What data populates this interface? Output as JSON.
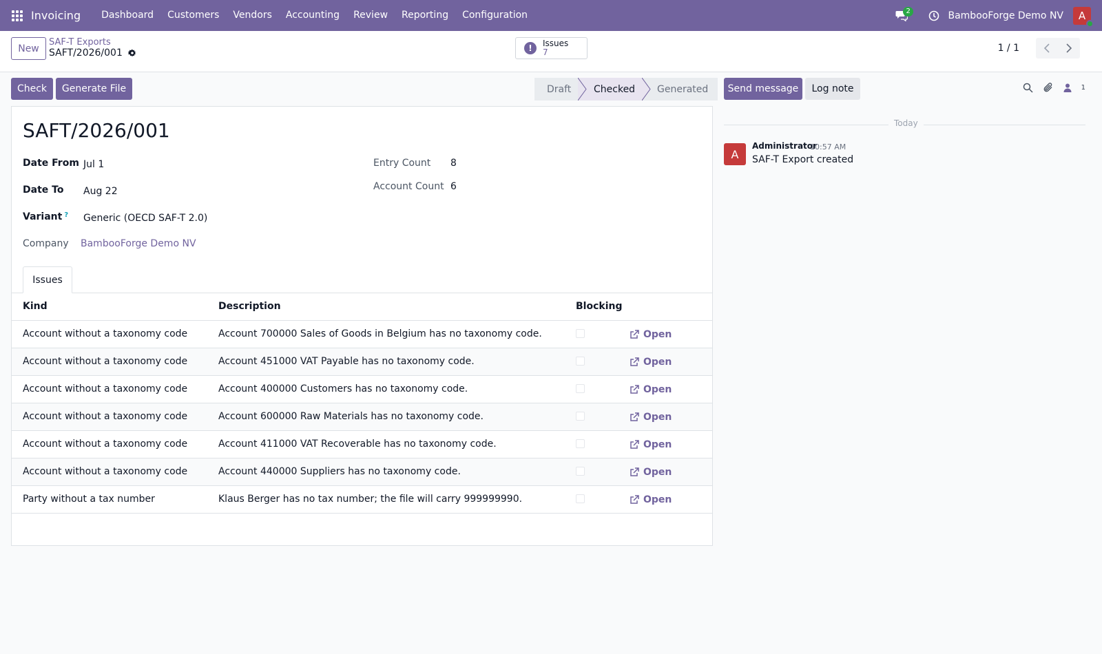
{
  "navbar": {
    "app_name": "Invoicing",
    "menu": [
      "Dashboard",
      "Customers",
      "Vendors",
      "Accounting",
      "Review",
      "Reporting",
      "Configuration"
    ],
    "chat_badge": "2",
    "company": "BambooForge Demo NV",
    "avatar_letter": "A"
  },
  "control_panel": {
    "new_label": "New",
    "breadcrumb": "SAF-T Exports",
    "record_name": "SAFT/2026/001",
    "smart_button": {
      "label": "Issues",
      "value": "7"
    },
    "pager": "1 / 1"
  },
  "actions": {
    "check_label": "Check",
    "generate_label": "Generate File"
  },
  "status": {
    "stages": [
      "Draft",
      "Checked",
      "Generated"
    ],
    "current": "Checked"
  },
  "form": {
    "title": "SAFT/2026/001",
    "date_from_label": "Date From",
    "date_from": "Jul 1",
    "date_to_label": "Date To",
    "date_to": "Aug 22",
    "variant_label": "Variant",
    "variant_help": "?",
    "variant": "Generic (OECD SAF-T 2.0)",
    "company_label": "Company",
    "company": "BambooForge Demo NV",
    "entry_count_label": "Entry Count",
    "entry_count": "8",
    "account_count_label": "Account Count",
    "account_count": "6"
  },
  "tabs": [
    "Issues"
  ],
  "table": {
    "headers": {
      "kind": "Kind",
      "description": "Description",
      "blocking": "Blocking"
    },
    "open_label": "Open",
    "rows": [
      {
        "kind": "Account without a taxonomy code",
        "description": "Account 700000 Sales of Goods in Belgium has no taxonomy code.",
        "blocking": false
      },
      {
        "kind": "Account without a taxonomy code",
        "description": "Account 451000 VAT Payable has no taxonomy code.",
        "blocking": false
      },
      {
        "kind": "Account without a taxonomy code",
        "description": "Account 400000 Customers has no taxonomy code.",
        "blocking": false
      },
      {
        "kind": "Account without a taxonomy code",
        "description": "Account 600000 Raw Materials has no taxonomy code.",
        "blocking": false
      },
      {
        "kind": "Account without a taxonomy code",
        "description": "Account 411000 VAT Recoverable has no taxonomy code.",
        "blocking": false
      },
      {
        "kind": "Account without a taxonomy code",
        "description": "Account 440000 Suppliers has no taxonomy code.",
        "blocking": false
      },
      {
        "kind": "Party without a tax number",
        "description": "Klaus Berger has no tax number; the file will carry 999999990.",
        "blocking": false
      }
    ]
  },
  "chatter": {
    "send_message_label": "Send message",
    "log_note_label": "Log note",
    "follower_count": "1",
    "date_separator": "Today",
    "messages": [
      {
        "avatar_letter": "A",
        "author": "Administrator",
        "time": "10:57 AM",
        "body": "SAF-T Export created"
      }
    ]
  },
  "colors": {
    "brand": "#71639e",
    "avatar": "#c53a3a",
    "online": "#28a745"
  }
}
